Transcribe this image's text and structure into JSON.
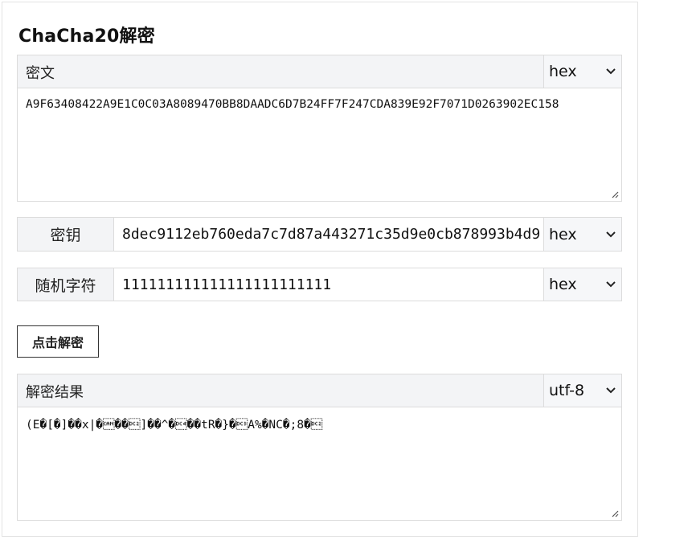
{
  "page": {
    "title": "ChaCha20解密"
  },
  "ciphertext": {
    "label": "密文",
    "format": "hex",
    "value": "A9F63408422A9E1C0C03A8089470BB8DAADC6D7B24FF7F247CDA839E92F7071D0263902EC158"
  },
  "key": {
    "label": "密钥",
    "value": "8dec9112eb760eda7c7d87a443271c35d9e0cb878993b4d9",
    "format": "hex"
  },
  "nonce": {
    "label": "随机字符",
    "value": "111111111111111111111111",
    "format": "hex"
  },
  "decrypt_button": {
    "label": "点击解密"
  },
  "result": {
    "label": "解密结果",
    "format": "utf-8",
    "value": "(E�[�]��x|�\u0018��\u0012]��^�\u0014��tR�}�\u0013A%�NC�;8�\u0012"
  },
  "icons": {
    "select": "chevron-down-icon",
    "resize": "resize-grip-icon"
  }
}
